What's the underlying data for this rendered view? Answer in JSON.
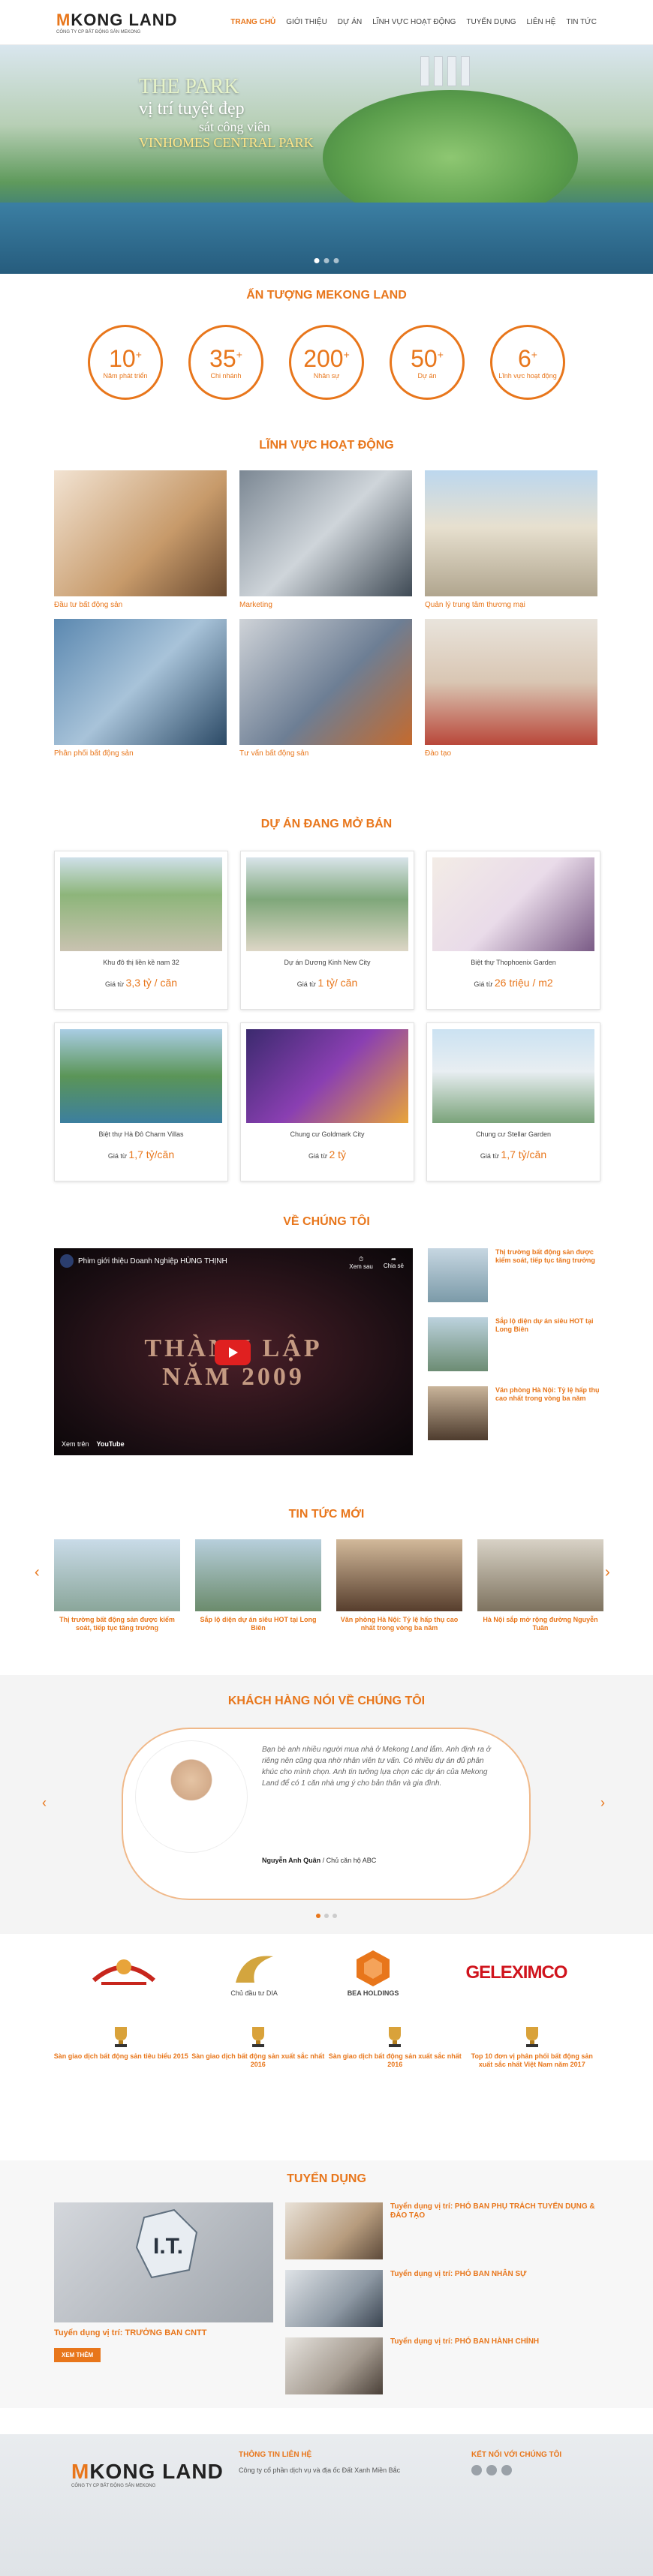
{
  "header": {
    "logo_main_prefix": "M",
    "logo_main_rest": "KONG LAND",
    "logo_sub": "CÔNG TY CP BẤT ĐỘNG SẢN MEKONG",
    "nav": [
      "TRANG CHỦ",
      "GIỚI THIỆU",
      "DỰ ÁN",
      "LĨNH VỰC HOẠT ĐỘNG",
      "TUYỂN DỤNG",
      "LIÊN HỆ",
      "TIN TỨC"
    ]
  },
  "hero": {
    "line1": "THE PARK",
    "line2": "vị trí tuyệt đẹp",
    "line3": "sát công viên",
    "line4": "VINHOMES CENTRAL PARK"
  },
  "stats": {
    "title": "ẤN TƯỢNG MEKONG LAND",
    "items": [
      {
        "num": "10",
        "label": "Năm phát triển"
      },
      {
        "num": "35",
        "label": "Chi nhánh"
      },
      {
        "num": "200",
        "label": "Nhân sự"
      },
      {
        "num": "50",
        "label": "Dự án"
      },
      {
        "num": "6",
        "label": "Lĩnh vực hoạt động"
      }
    ]
  },
  "fields": {
    "title": "LĨNH VỰC HOẠT ĐỘNG",
    "items": [
      "Đầu tư bất động sản",
      "Marketing",
      "Quản lý trung tâm thương mại",
      "Phân phối bất động sản",
      "Tư vấn bất động sản",
      "Đào tạo"
    ]
  },
  "projects": {
    "title": "DỰ ÁN ĐANG MỞ BÁN",
    "price_prefix": "Giá từ",
    "items": [
      {
        "name": "Khu đô thị liền kề nam 32",
        "price": "3,3 tỷ / căn"
      },
      {
        "name": "Dự án Dương Kinh New City",
        "price": "1 tỷ/ căn"
      },
      {
        "name": "Biệt thự Thophoenix Garden",
        "price": "26 triệu / m2"
      },
      {
        "name": "Biệt thự Hà Đô Charm Villas",
        "price": "1,7 tỷ/căn"
      },
      {
        "name": "Chung cư Goldmark City",
        "price": "2 tỷ"
      },
      {
        "name": "Chung cư Stellar Garden",
        "price": "1,7 tỷ/căn"
      }
    ]
  },
  "about": {
    "title": "VỀ CHÚNG TÔI",
    "video": {
      "title": "Phim giới thiệu Doanh Nghiệp HÙNG THỊNH",
      "watch_later": "Xem sau",
      "share": "Chia sẻ",
      "big_text_1": "THÀNH LẬP",
      "big_text_2": "NĂM 2009",
      "watch_on": "Xem trên",
      "platform": "YouTube"
    },
    "news": [
      {
        "title": "Thị trường bất động sản được kiểm soát, tiếp tục tăng trưởng",
        "desc": ""
      },
      {
        "title": "Sắp lộ diện dự án siêu HOT tại Long Biên",
        "desc": ""
      },
      {
        "title": "Văn phòng Hà Nội: Tỷ lệ hấp thụ cao nhất trong vòng ba năm",
        "desc": ""
      }
    ]
  },
  "latest": {
    "title": "TIN TỨC MỚI",
    "items": [
      "Thị trường bất động sản được kiểm soát, tiếp tục tăng trưởng",
      "Sắp lộ diện dự án siêu HOT tại Long Biên",
      "Văn phòng Hà Nội: Tỷ lệ hấp thụ cao nhất trong vòng ba năm",
      "Hà Nội sắp mở rộng đường Nguyễn Tuân"
    ]
  },
  "testimonial": {
    "title": "KHÁCH HÀNG NÓI VỀ CHÚNG TÔI",
    "text": "Bạn bè anh nhiều người mua nhà ở Mekong Land lắm. Anh định ra ở riêng nên cũng qua nhờ nhân viên tư vấn. Có nhiều dự án đủ phân khúc cho mình chọn. Anh tin tưởng lựa chọn các dự án của Mekong Land để có 1 căn nhà ưng ý cho bản thân và gia đình.",
    "author": "Nguyễn Anh Quân",
    "role": " / Chủ căn hộ ABC"
  },
  "partners": {
    "items": [
      "",
      "Chủ đầu tư DIA",
      "BEA HOLDINGS",
      "GELEXIMCO"
    ],
    "awards": [
      {
        "title": "Sàn giao dịch bất động sản tiêu biểu 2015",
        "desc": ""
      },
      {
        "title": "Sàn giao dịch bất động sản xuất sắc nhất 2016",
        "desc": ""
      },
      {
        "title": "Sàn giao dịch bất động sản xuất sắc nhất 2016",
        "desc": ""
      },
      {
        "title": "Top 10 đơn vị phân phối bất động sản xuất sắc nhất Việt Nam năm 2017",
        "desc": ""
      }
    ]
  },
  "recruit": {
    "title": "TUYỂN DỤNG",
    "main": {
      "title": "Tuyển dụng vị trí: TRƯỞNG BAN CNTT",
      "desc": "",
      "button": "XEM THÊM"
    },
    "items": [
      {
        "title": "Tuyển dụng vị trí: PHÓ BAN PHỤ TRÁCH TUYỂN DỤNG & ĐÀO TẠO",
        "desc": ""
      },
      {
        "title": "Tuyển dụng vị trí: PHÓ BAN NHÂN SỰ",
        "desc": ""
      },
      {
        "title": "Tuyển dụng vị trí: PHÓ BAN HÀNH CHÍNH",
        "desc": ""
      }
    ]
  },
  "footer": {
    "contact_title": "THÔNG TIN LIÊN HỆ",
    "contact_lines": [
      "Công ty cổ phần dịch vụ và địa ốc Đất Xanh Miền Bắc",
      "",
      "",
      "",
      ""
    ],
    "social_title": "KẾT NỐI VỚI CHÚNG TÔI",
    "social_lines": [
      "",
      "",
      ""
    ]
  },
  "colors": {
    "accent": "#e8761b"
  }
}
